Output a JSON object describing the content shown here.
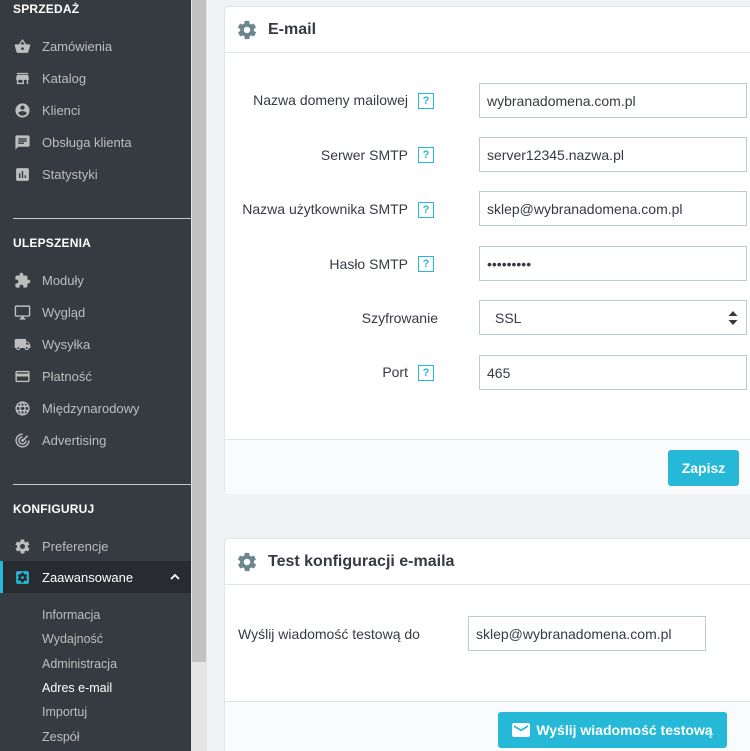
{
  "sidebar": {
    "sections": {
      "sales": "SPRZEDAŻ",
      "improve": "ULEPSZENIA",
      "configure": "KONFIGURUJ"
    },
    "sales_items": [
      {
        "label": "Zamówienia",
        "icon": "basket-icon"
      },
      {
        "label": "Katalog",
        "icon": "store-icon"
      },
      {
        "label": "Klienci",
        "icon": "account-circle-icon"
      },
      {
        "label": "Obsługa klienta",
        "icon": "chat-icon"
      },
      {
        "label": "Statystyki",
        "icon": "bar-chart-icon"
      }
    ],
    "improve_items": [
      {
        "label": "Moduły",
        "icon": "puzzle-icon"
      },
      {
        "label": "Wygląd",
        "icon": "monitor-icon"
      },
      {
        "label": "Wysyłka",
        "icon": "truck-icon"
      },
      {
        "label": "Płatność",
        "icon": "credit-card-icon"
      },
      {
        "label": "Międzynarodowy",
        "icon": "globe-icon"
      },
      {
        "label": "Advertising",
        "icon": "radar-icon"
      }
    ],
    "configure_items": [
      {
        "label": "Preferencje",
        "icon": "gear-icon"
      },
      {
        "label": "Zaawansowane",
        "icon": "settings-applications-icon",
        "active": true
      }
    ],
    "sub_items": [
      "Informacja",
      "Wydajność",
      "Administracja",
      "Adres e-mail",
      "Importuj",
      "Zespół"
    ],
    "current_sub": "Adres e-mail"
  },
  "email_panel": {
    "title": "E-mail",
    "fields": {
      "domain": {
        "label": "Nazwa domeny mailowej",
        "value": "wybranadomena.com.pl"
      },
      "server": {
        "label": "Serwer SMTP",
        "value": "server12345.nazwa.pl"
      },
      "user": {
        "label": "Nazwa użytkownika SMTP",
        "value": "sklep@wybranadomena.com.pl"
      },
      "password": {
        "label": "Hasło SMTP",
        "value": "•••••••••"
      },
      "encryption": {
        "label": "Szyfrowanie",
        "value": "SSL"
      },
      "port": {
        "label": "Port",
        "value": "465"
      }
    },
    "help_glyph": "?",
    "save_label": "Zapisz"
  },
  "test_panel": {
    "title": "Test konfiguracji e-maila",
    "label": "Wyślij wiadomość testową do",
    "value": "sklep@wybranadomena.com.pl",
    "send_label": "Wyślij wiadomość testową"
  },
  "colors": {
    "sidebar_bg": "#363a41",
    "accent": "#25b9d7",
    "page_bg": "#eff1f2"
  }
}
